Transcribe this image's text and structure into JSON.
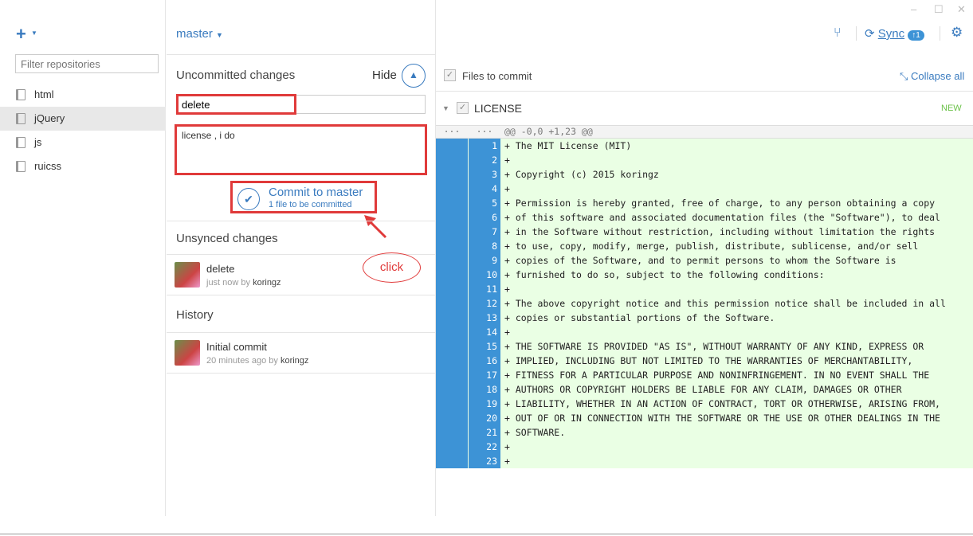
{
  "window": {
    "minimize": "–",
    "maximize": "☐",
    "close": "✕"
  },
  "sidebar": {
    "add_icon": "plus-icon",
    "filter_placeholder": "Filter repositories",
    "repos": [
      {
        "label": "html"
      },
      {
        "label": "jQuery",
        "selected": true
      },
      {
        "label": "js"
      },
      {
        "label": "ruicss"
      }
    ]
  },
  "toolbar": {
    "branch": "master",
    "sync_label": "Sync",
    "sync_badge": "↑1",
    "accent": "#3a7bbf"
  },
  "uncommitted": {
    "title": "Uncommitted changes",
    "hide_label": "Hide",
    "summary": "delete",
    "description": "license , i do",
    "commit_title": "Commit to master",
    "commit_sub": "1 file to be committed"
  },
  "annotation": {
    "click_label": "click",
    "color": "#e03a3a"
  },
  "unsynced": {
    "title": "Unsynced changes",
    "commits": [
      {
        "title": "delete",
        "time": "just now by",
        "author": "koringz"
      }
    ]
  },
  "history": {
    "title": "History",
    "commits": [
      {
        "title": "Initial commit",
        "time": "20 minutes ago by",
        "author": "koringz"
      }
    ]
  },
  "diff": {
    "files_to_commit": "Files to commit",
    "collapse_all": "Collapse all",
    "file_name": "LICENSE",
    "file_status": "NEW",
    "hunk_gutter": "···",
    "hunk": "@@ -0,0 +1,23 @@",
    "lines": [
      "+ The MIT License (MIT)",
      "+",
      "+ Copyright (c) 2015 koringz",
      "+",
      "+ Permission is hereby granted, free of charge, to any person obtaining a copy",
      "+ of this software and associated documentation files (the \"Software\"), to deal",
      "+ in the Software without restriction, including without limitation the rights",
      "+ to use, copy, modify, merge, publish, distribute, sublicense, and/or sell",
      "+ copies of the Software, and to permit persons to whom the Software is",
      "+ furnished to do so, subject to the following conditions:",
      "+",
      "+ The above copyright notice and this permission notice shall be included in all",
      "+ copies or substantial portions of the Software.",
      "+",
      "+ THE SOFTWARE IS PROVIDED \"AS IS\", WITHOUT WARRANTY OF ANY KIND, EXPRESS OR",
      "+ IMPLIED, INCLUDING BUT NOT LIMITED TO THE WARRANTIES OF MERCHANTABILITY,",
      "+ FITNESS FOR A PARTICULAR PURPOSE AND NONINFRINGEMENT. IN NO EVENT SHALL THE",
      "+ AUTHORS OR COPYRIGHT HOLDERS BE LIABLE FOR ANY CLAIM, DAMAGES OR OTHER",
      "+ LIABILITY, WHETHER IN AN ACTION OF CONTRACT, TORT OR OTHERWISE, ARISING FROM,",
      "+ OUT OF OR IN CONNECTION WITH THE SOFTWARE OR THE USE OR OTHER DEALINGS IN THE",
      "+ SOFTWARE.",
      "+",
      "+"
    ]
  }
}
